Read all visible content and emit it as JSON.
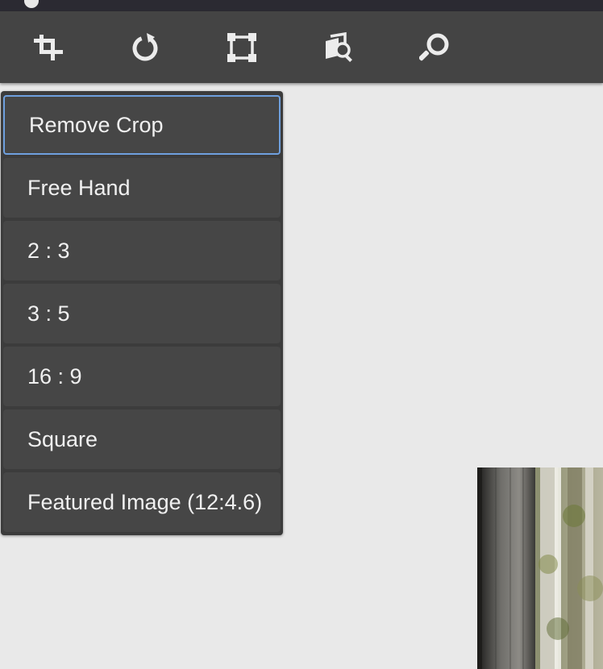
{
  "toolbar": {
    "tools": [
      {
        "icon": "crop-icon"
      },
      {
        "icon": "rotate-icon"
      },
      {
        "icon": "transform-icon"
      },
      {
        "icon": "map-preview-icon"
      },
      {
        "icon": "search-icon"
      }
    ]
  },
  "crop_menu": {
    "items": [
      {
        "label": "Remove Crop",
        "selected": true
      },
      {
        "label": "Free Hand",
        "selected": false
      },
      {
        "label": "2 : 3",
        "selected": false
      },
      {
        "label": "3 : 5",
        "selected": false
      },
      {
        "label": "16 : 9",
        "selected": false
      },
      {
        "label": "Square",
        "selected": false
      },
      {
        "label": "Featured Image (12:4.6)",
        "selected": false
      }
    ]
  },
  "colors": {
    "toolbar_bg": "#444444",
    "menu_item_bg": "#464646",
    "focus_ring": "#6fa0df",
    "canvas_bg": "#e9e9e9"
  }
}
